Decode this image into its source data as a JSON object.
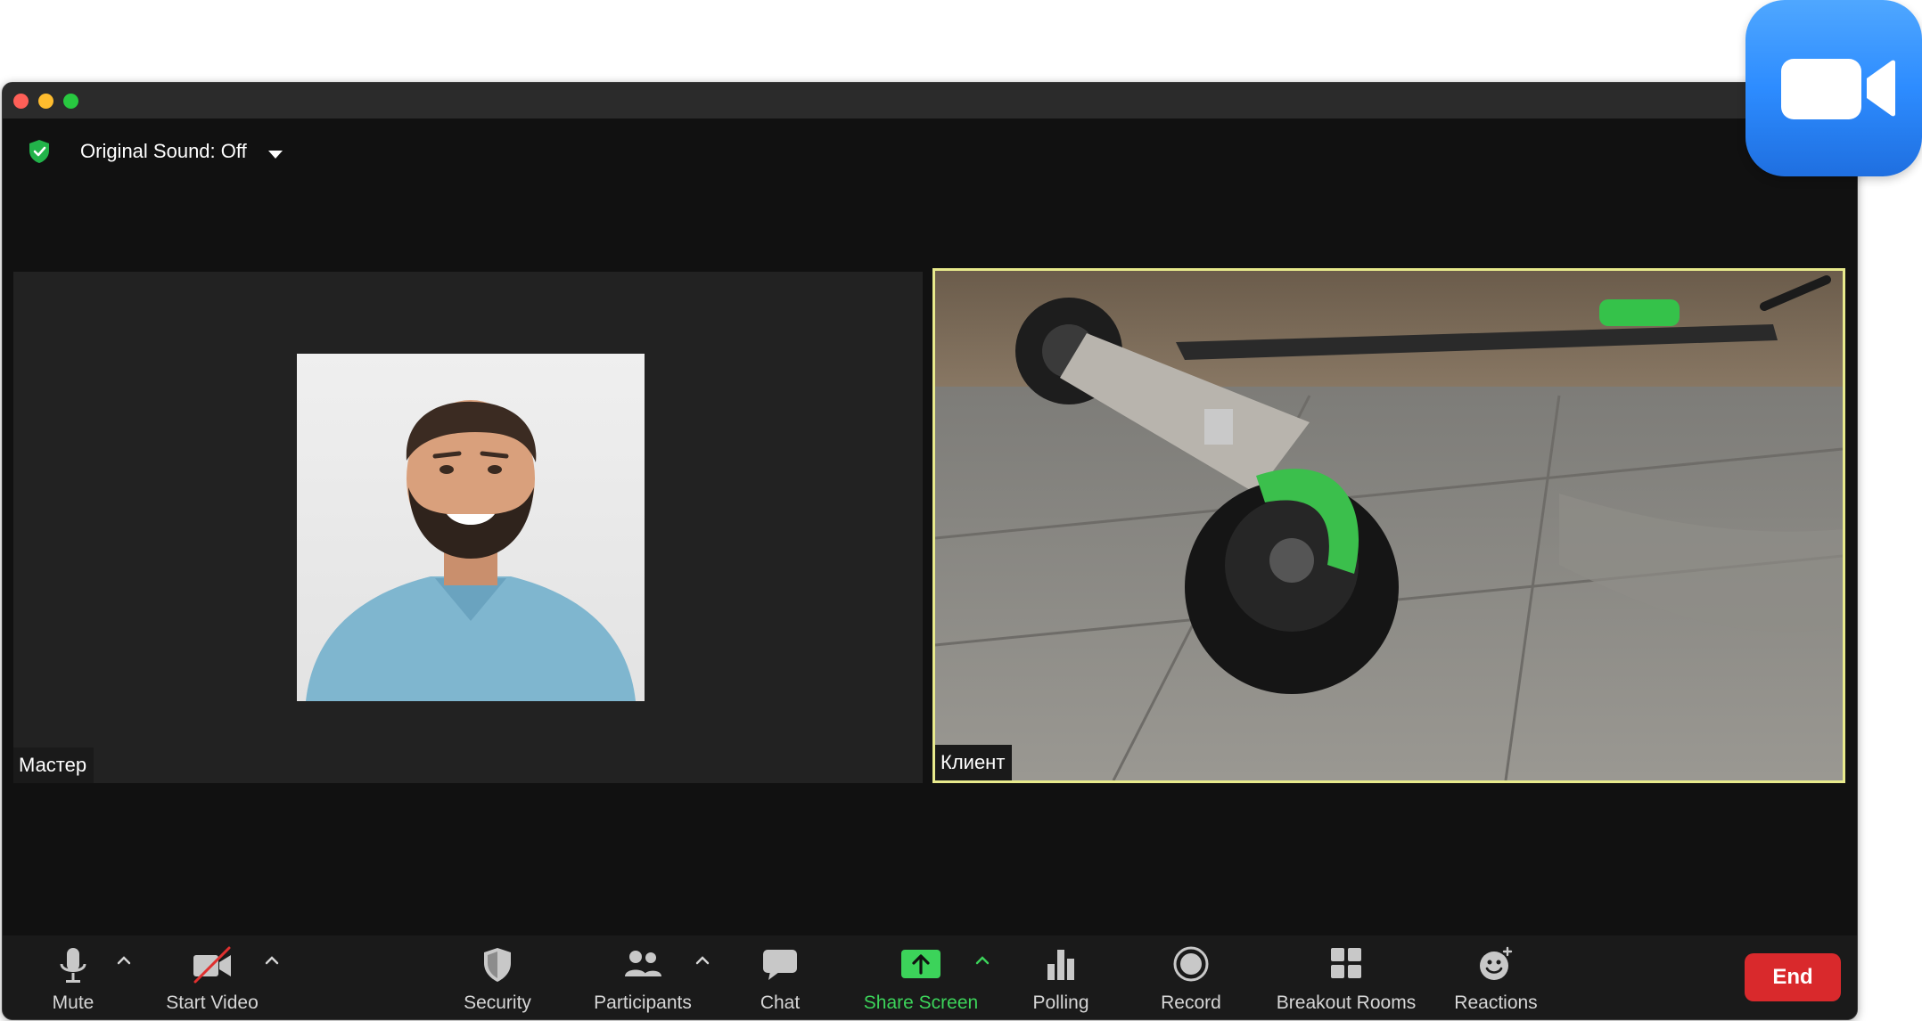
{
  "top_bar": {
    "original_sound_label": "Original Sound: Off"
  },
  "participants": [
    {
      "name": "Мастер"
    },
    {
      "name": "Клиент"
    }
  ],
  "toolbar": {
    "mute_label": "Mute",
    "start_video_label": "Start Video",
    "security_label": "Security",
    "participants_label": "Participants",
    "chat_label": "Chat",
    "share_screen_label": "Share Screen",
    "polling_label": "Polling",
    "record_label": "Record",
    "breakout_rooms_label": "Breakout Rooms",
    "reactions_label": "Reactions",
    "end_label": "End"
  },
  "colors": {
    "share_screen_accent": "#3cd35a",
    "end_button": "#d9292c",
    "active_speaker_border": "#e8ea8c",
    "app_icon_blue": "#2d8cff"
  }
}
